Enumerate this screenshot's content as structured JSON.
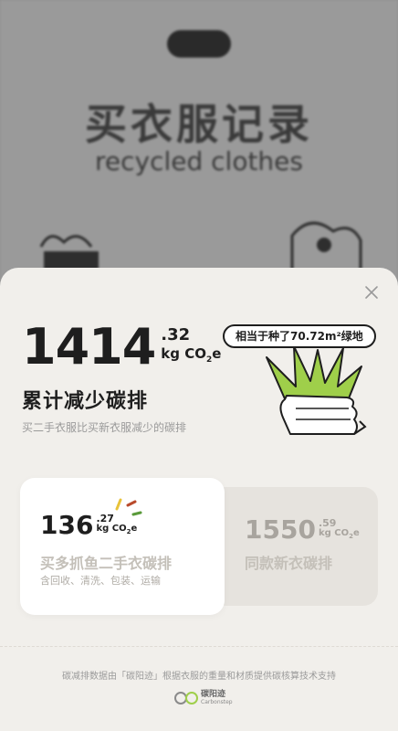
{
  "background": {
    "tabs": [
      "",
      "",
      ""
    ],
    "title": "买衣服记录",
    "subtitle": "recycled clothes"
  },
  "total": {
    "integer": "1414",
    "decimal": ".32",
    "unit": "kg CO",
    "unit_sub": "2",
    "unit_tail": "e",
    "title": "累计减少碳排",
    "description": "买二手衣服比买新衣服减少的碳排",
    "equivalent": "相当于种了70.72m²绿地"
  },
  "cards": {
    "secondhand": {
      "integer": "136",
      "decimal": ".27",
      "unit": "kg CO",
      "unit_sub": "2",
      "unit_tail": "e",
      "title": "买多抓鱼二手衣碳排",
      "description": "含回收、清洗、包装、运输"
    },
    "new": {
      "integer": "1550",
      "decimal": ".59",
      "unit": "kg CO",
      "unit_sub": "2",
      "unit_tail": "e",
      "title": "同款新衣碳排"
    }
  },
  "footer": {
    "note": "碳减排数据由「碳阳迹」根据衣服的重量和材质提供碳核算技术支持",
    "brand_cn": "碳阳迹",
    "brand_en": "Carbonstep"
  },
  "colors": {
    "sheet": "#f1efeb",
    "grass": "#9fcf4a",
    "text": "#1e1e1e"
  }
}
